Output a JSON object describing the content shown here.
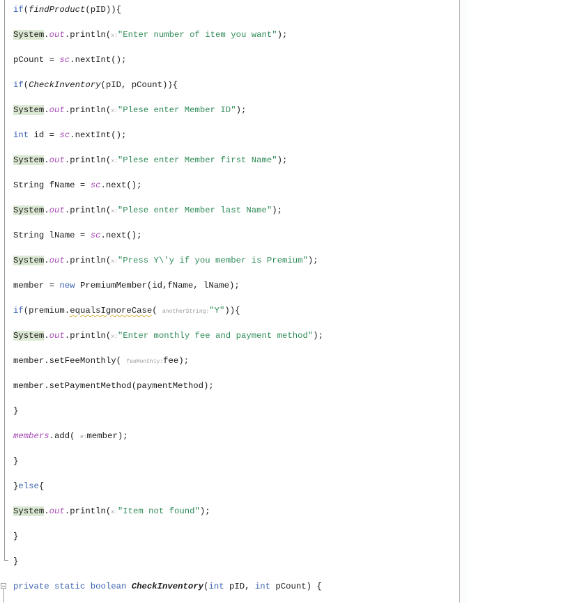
{
  "editor": {
    "lines": [
      {
        "id": "l1",
        "parts": [
          "if",
          "(",
          "findProduct",
          "(pID)){"
        ]
      },
      {
        "id": "l2",
        "class": "System",
        "field": "out",
        "method": ".println(",
        "hint": "x:",
        "string": "\"Enter number of item you want\"",
        "end": ");"
      },
      {
        "id": "l3",
        "text_a": "pCount = ",
        "field": "sc",
        "text_b": ".nextInt();"
      },
      {
        "id": "l4",
        "parts": [
          "if",
          "(",
          "CheckInventory",
          "(pID, pCount)){"
        ]
      },
      {
        "id": "l5",
        "class": "System",
        "field": "out",
        "method": ".println(",
        "hint": "x:",
        "string": "\"Plese enter Member ID\"",
        "end": ");"
      },
      {
        "id": "l6",
        "kw": "int",
        "text_a": " id = ",
        "field": "sc",
        "text_b": ".nextInt();"
      },
      {
        "id": "l7",
        "class": "System",
        "field": "out",
        "method": ".println(",
        "hint": "x:",
        "string": "\"Plese enter Member first Name\"",
        "end": ");"
      },
      {
        "id": "l8",
        "text_a": "String fName = ",
        "field": "sc",
        "text_b": ".next();"
      },
      {
        "id": "l9",
        "class": "System",
        "field": "out",
        "method": ".println(",
        "hint": "x:",
        "string": "\"Plese enter Member last Name\"",
        "end": ");"
      },
      {
        "id": "l10",
        "text_a": "String lName = ",
        "field": "sc",
        "text_b": ".next();"
      },
      {
        "id": "l11",
        "class": "System",
        "field": "out",
        "method": ".println(",
        "hint": "x:",
        "string": "\"Press Y\\'y if you member is Premium\"",
        "end": ");"
      },
      {
        "id": "l12",
        "text_a": "member = ",
        "kw": "new",
        "text_b": " PremiumMember(id,fName, lName);"
      },
      {
        "id": "l13",
        "kw": "if",
        "text_a": "(premium.",
        "warn": "equalsIgnoreCase",
        "text_b": "( ",
        "hint": "anotherString:",
        "string": "\"Y\"",
        "end": ")){"
      },
      {
        "id": "l14",
        "class": "System",
        "field": "out",
        "method": ".println(",
        "hint": "x:",
        "string": "\"Enter monthly fee and payment method\"",
        "end": ");"
      },
      {
        "id": "l15",
        "text_a": "member.setFeeMonthly( ",
        "hint": "feeMonthly:",
        "text_b": "fee);"
      },
      {
        "id": "l16",
        "text": "member.setPaymentMethod(paymentMethod);"
      },
      {
        "id": "l17",
        "text": "}"
      },
      {
        "id": "l18",
        "field": "members",
        "text_a": ".add( ",
        "hint": "e:",
        "text_b": "member);"
      },
      {
        "id": "l19",
        "text": "}"
      },
      {
        "id": "l20",
        "text_a": "}",
        "kw": "else",
        "text_b": "{"
      },
      {
        "id": "l21",
        "class": "System",
        "field": "out",
        "method": ".println(",
        "hint": "x:",
        "string": "\"Item not found\"",
        "end": ");"
      },
      {
        "id": "l22",
        "text": "}"
      },
      {
        "id": "l23",
        "text": "}"
      },
      {
        "id": "l24",
        "kw1": "private static boolean ",
        "name": "CheckInventory",
        "text_a": "(",
        "kw2": "int",
        "text_b": " pID, ",
        "kw3": "int",
        "text_c": " pCount) {"
      }
    ]
  },
  "colors": {
    "keyword": "#3b63b0",
    "string": "#2e8b57",
    "static_field": "#a648b5",
    "system_highlight": "#dbe8d3",
    "param_hint": "#9a9a9a"
  }
}
